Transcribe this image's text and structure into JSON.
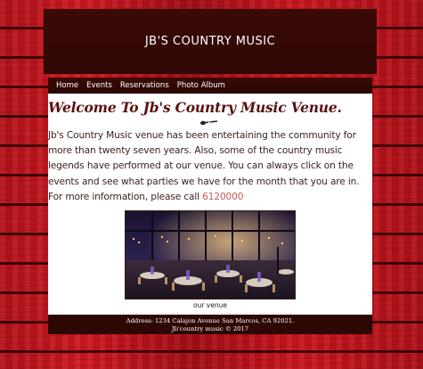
{
  "header": {
    "title": "JB'S COUNTRY MUSIC"
  },
  "nav": {
    "items": [
      {
        "label": "Home"
      },
      {
        "label": "Events"
      },
      {
        "label": "Reservations"
      },
      {
        "label": "Photo Album"
      }
    ]
  },
  "main": {
    "heading": "Welcome To Jb's Country Music Venue.",
    "intro": "Jb's Country Music venue has been entertaining the community for more than twenty seven years. Also, some of the country music legends have performed at our venue. You can always click on the events and see what parties we have for the month that you are in. For more information, please call ",
    "phone": "6120000",
    "photo_caption": "our venue"
  },
  "footer": {
    "address": "Address: 1234 Calajon Avenue San Marcos, CA 92021.",
    "copyright": "Jb'country music © 2017"
  },
  "colors": {
    "header_bg": "#3a0a06",
    "heading": "#5a1210",
    "phone_link": "#c25a54",
    "background_wood": "#c0161e"
  }
}
